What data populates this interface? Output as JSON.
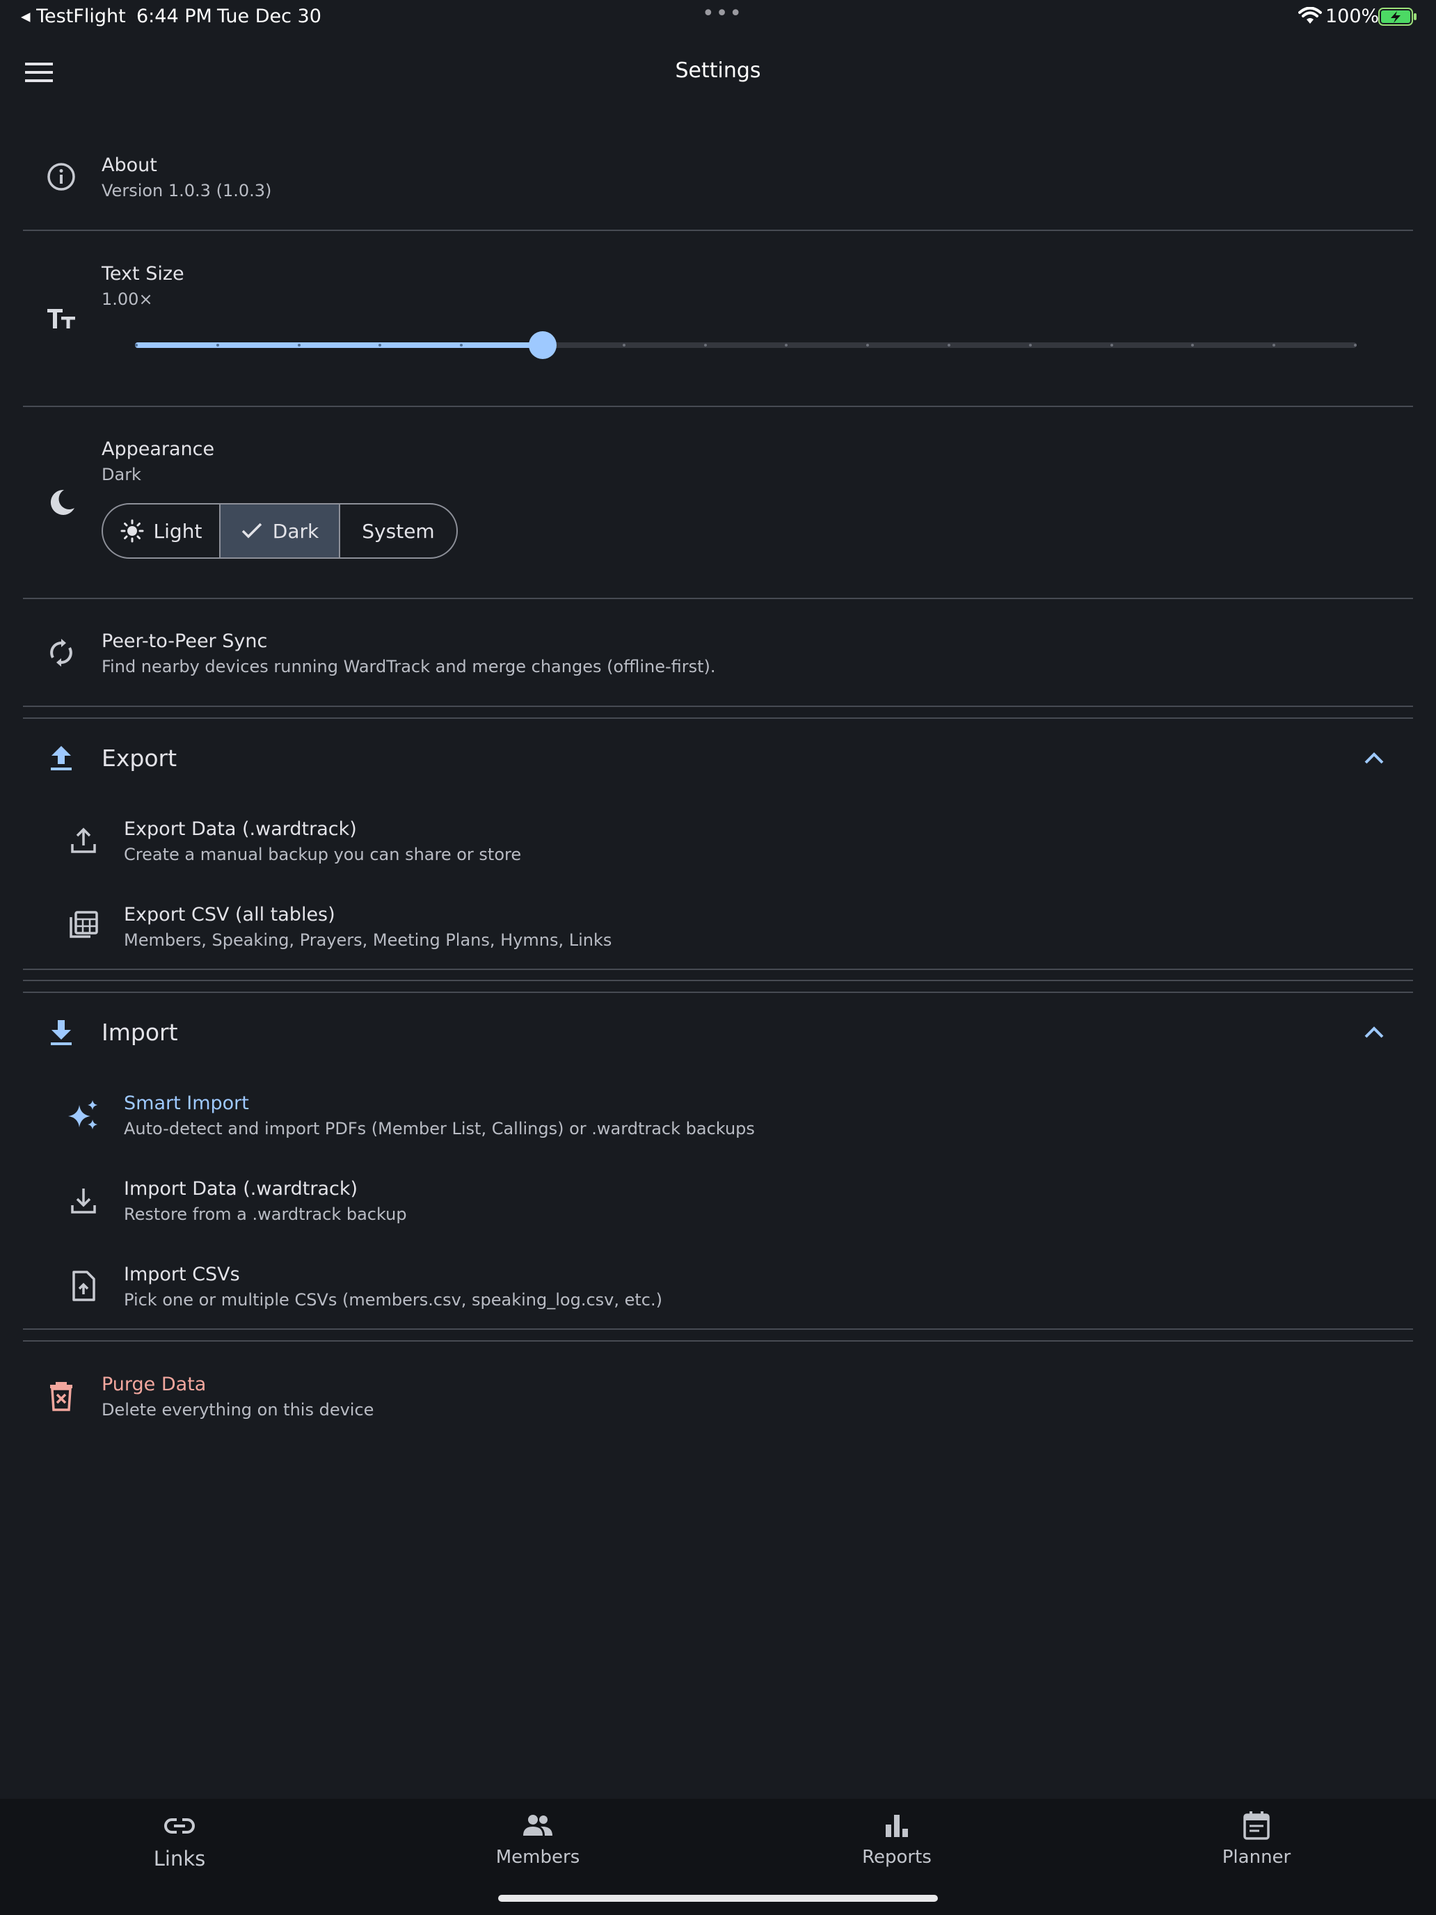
{
  "status_bar": {
    "back_app": "◂ TestFlight",
    "time": "6:44 PM",
    "date": "Tue Dec 30",
    "multitask_dots": "•••",
    "battery": "100%",
    "icons": [
      "wifi-icon",
      "battery-charging-icon"
    ]
  },
  "header": {
    "title": "Settings",
    "menu_icon": "hamburger-menu-icon"
  },
  "about": {
    "title": "About",
    "subtitle": "Version 1.0.3 (1.0.3)",
    "icon": "info-icon"
  },
  "text_size": {
    "title": "Text Size",
    "value_label": "1.00×",
    "icon": "text-size-icon",
    "slider_steps": 16,
    "slider_index": 5
  },
  "appearance": {
    "title": "Appearance",
    "subtitle": "Dark",
    "icon": "moon-icon",
    "options": [
      {
        "label": "Light",
        "icon": "sun-icon",
        "selected": false
      },
      {
        "label": "Dark",
        "icon": "check-icon",
        "selected": true
      },
      {
        "label": "System",
        "selected": false
      }
    ]
  },
  "sync": {
    "title": "Peer-to-Peer Sync",
    "subtitle": "Find nearby devices running WardTrack and merge changes (offline-first).",
    "icon": "sync-icon"
  },
  "export": {
    "title": "Export",
    "icon": "upload-icon",
    "expanded": true,
    "items": [
      {
        "title": "Export Data (.wardtrack)",
        "subtitle": "Create a manual backup you can share or store",
        "icon": "share-upload-icon"
      },
      {
        "title": "Export CSV (all tables)",
        "subtitle": "Members, Speaking, Prayers, Meeting Plans, Hymns, Links",
        "icon": "table-icon"
      }
    ]
  },
  "import": {
    "title": "Import",
    "icon": "download-icon",
    "expanded": true,
    "items": [
      {
        "title": "Smart Import",
        "subtitle": "Auto-detect and import PDFs (Member List, Callings) or .wardtrack backups",
        "icon": "sparkle-icon"
      },
      {
        "title": "Import Data (.wardtrack)",
        "subtitle": "Restore from a .wardtrack backup",
        "icon": "download-tray-icon"
      },
      {
        "title": "Import CSVs",
        "subtitle": "Pick one or multiple CSVs (members.csv, speaking_log.csv, etc.)",
        "icon": "file-upload-icon"
      }
    ]
  },
  "purge": {
    "title": "Purge Data",
    "subtitle": "Delete everything on this device",
    "icon": "trash-icon"
  },
  "bottom_nav": [
    {
      "label": "Links",
      "icon": "link-icon"
    },
    {
      "label": "Members",
      "icon": "people-icon"
    },
    {
      "label": "Reports",
      "icon": "bar-chart-icon"
    },
    {
      "label": "Planner",
      "icon": "calendar-icon"
    }
  ],
  "colors": {
    "background": "#181b20",
    "accent": "#9ec9ff",
    "danger": "#f2a79e",
    "text": "#e3e3e8",
    "subtext": "#b9bcc4",
    "selected_segment": "#3f4a5a"
  }
}
